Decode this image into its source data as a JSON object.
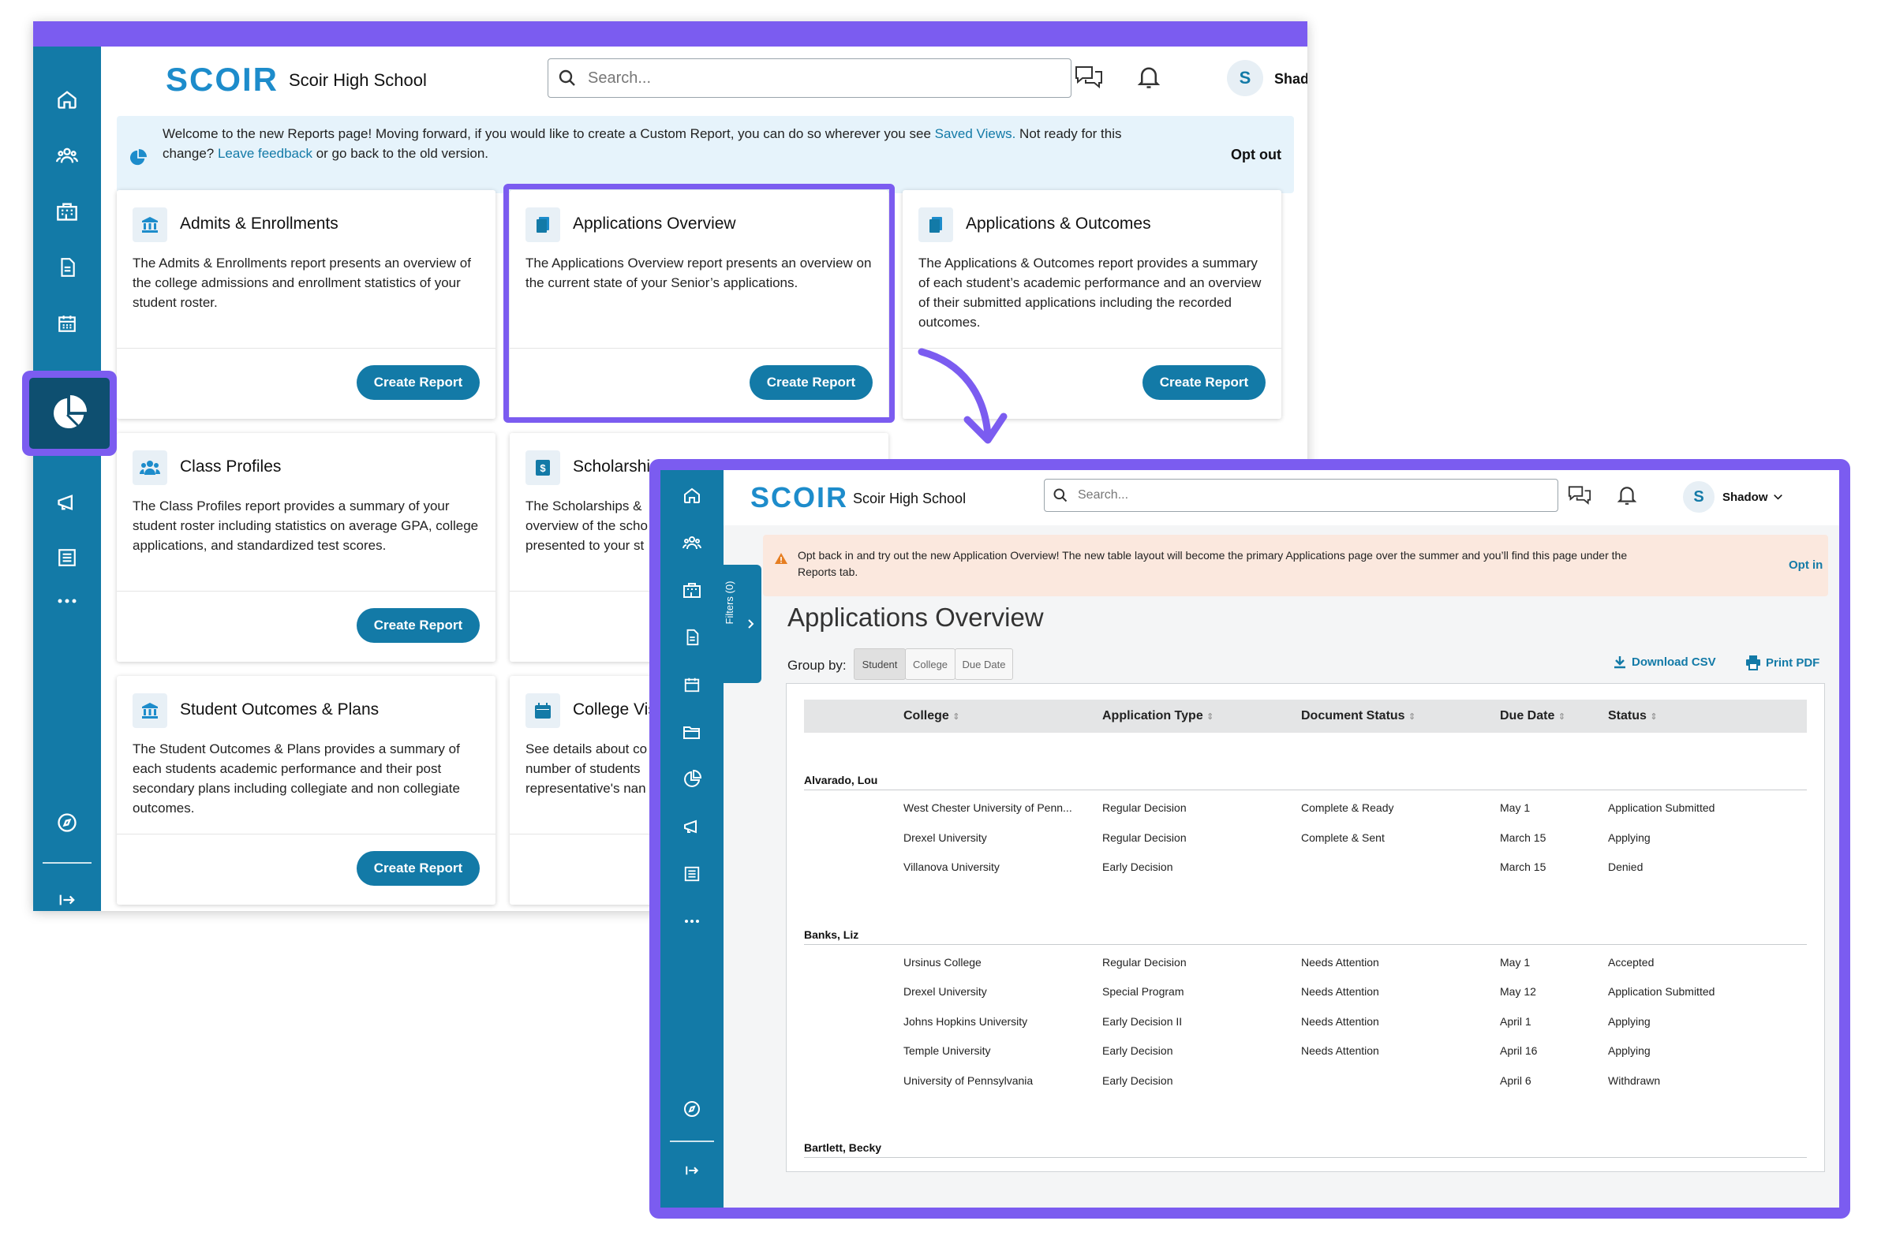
{
  "colors": {
    "brand": "#137aa7",
    "accent": "#7b5cf0",
    "logo": "#1d8ccb",
    "warning": "#e67e22"
  },
  "reports_page": {
    "logo": "SCOIR",
    "school": "Scoir High School",
    "search_placeholder": "Search...",
    "user_initial": "S",
    "user_name": "Shadow",
    "banner": {
      "text1": "Welcome to the new Reports page! Moving forward, if you would like to create a Custom Report, you can do so wherever you see ",
      "link1": "Saved Views.",
      "text2": " Not ready for this",
      "text3": "change? ",
      "link2": "Leave feedback",
      "text4": " or go back to the old version.",
      "opt_out": "Opt out"
    },
    "cards": [
      {
        "title": "Admits & Enrollments",
        "icon": "bank-icon",
        "desc": "The Admits & Enrollments report presents an overview of the college admissions and enrollment statistics of your student roster.",
        "button": "Create Report"
      },
      {
        "title": "Applications Overview",
        "icon": "documents-icon",
        "desc": "The Applications Overview report presents an overview on the current state of your Senior’s applications.",
        "button": "Create Report"
      },
      {
        "title": "Applications & Outcomes",
        "icon": "documents-icon",
        "desc": "The Applications & Outcomes report provides a summary of each student’s academic performance and an overview of their submitted applications including the recorded outcomes.",
        "button": "Create Report"
      },
      {
        "title": "Class Profiles",
        "icon": "people-icon",
        "desc": "The Class Profiles report provides a summary of your student roster including statistics on average GPA, college applications, and standardized test scores.",
        "button": "Create Report"
      },
      {
        "title": "Scholarshi",
        "icon": "dollar-icon",
        "desc": "The Scholarships & overview of the scho presented to your st",
        "button": ""
      },
      {
        "title": "Student Outcomes & Plans",
        "icon": "bank-icon",
        "desc": "The Student Outcomes & Plans provides a summary of each students academic performance and their post secondary plans including collegiate and non collegiate outcomes.",
        "button": "Create Report"
      },
      {
        "title": "College Vis",
        "icon": "calendar-icon",
        "desc": "See details about co number of students representative's nan",
        "button": ""
      }
    ]
  },
  "applications_page": {
    "logo": "SCOIR",
    "school": "Scoir High School",
    "search_placeholder": "Search...",
    "user_initial": "S",
    "user_name": "Shadow",
    "banner": {
      "line1": "Opt back in and try out the new Application Overview! The new table layout will become the primary Applications page over the summer and you’ll find this page under the",
      "line2": "Reports tab.",
      "opt_in": "Opt in"
    },
    "filters_label": "Filters (0)",
    "title": "Applications Overview",
    "group_by_label": "Group by:",
    "group_by_options": [
      "Student",
      "College",
      "Due Date"
    ],
    "download_csv": "Download CSV",
    "print_pdf": "Print PDF",
    "columns": [
      "College",
      "Application Type",
      "Document Status",
      "Due Date",
      "Status"
    ],
    "groups": [
      {
        "student": "Alvarado, Lou",
        "rows": [
          [
            "West Chester University of Penn...",
            "Regular Decision",
            "Complete & Ready",
            "May 1",
            "Application Submitted"
          ],
          [
            "Drexel University",
            "Regular Decision",
            "Complete & Sent",
            "March 15",
            "Applying"
          ],
          [
            "Villanova University",
            "Early Decision",
            "",
            "March 15",
            "Denied"
          ]
        ]
      },
      {
        "student": "Banks, Liz",
        "rows": [
          [
            "Ursinus College",
            "Regular Decision",
            "Needs Attention",
            "May 1",
            "Accepted"
          ],
          [
            "Drexel University",
            "Special Program",
            "Needs Attention",
            "May 12",
            "Application Submitted"
          ],
          [
            "Johns Hopkins University",
            "Early Decision II",
            "Needs Attention",
            "April 1",
            "Applying"
          ],
          [
            "Temple University",
            "Early Decision",
            "Needs Attention",
            "April 16",
            "Applying"
          ],
          [
            "University of Pennsylvania",
            "Early Decision",
            "",
            "April 6",
            "Withdrawn"
          ]
        ]
      },
      {
        "student": "Bartlett, Becky",
        "rows": []
      }
    ]
  }
}
